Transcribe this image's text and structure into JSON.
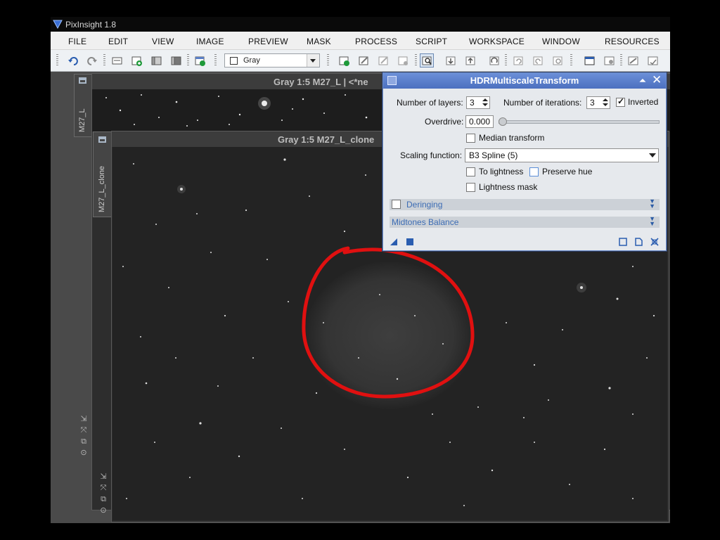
{
  "app": {
    "title": "PixInsight 1.8"
  },
  "menu": [
    "FILE",
    "EDIT",
    "VIEW",
    "IMAGE",
    "PREVIEW",
    "MASK",
    "PROCESS",
    "SCRIPT",
    "WORKSPACE",
    "WINDOW",
    "RESOURCES"
  ],
  "toolbar": {
    "color_mode": "Gray",
    "icons": [
      "undo-icon",
      "redo-icon",
      "new-image-icon",
      "duplicate-icon",
      "clone-icon",
      "mask-icon",
      "new-preview-icon",
      "zoom-icon",
      "process-icon"
    ]
  },
  "windows": {
    "back": {
      "title": "Gray 1:5 M27_L | <*ne",
      "tab": "M27_L"
    },
    "front": {
      "title": "Gray 1:5 M27_L_clone",
      "tab": "M27_L_clone"
    }
  },
  "dialog": {
    "title": "HDRMultiscaleTransform",
    "layers_label": "Number of layers:",
    "layers_value": "3",
    "iterations_label": "Number of iterations:",
    "iterations_value": "3",
    "inverted_label": "Inverted",
    "inverted_checked": true,
    "overdrive_label": "Overdrive:",
    "overdrive_value": "0.000",
    "overdrive_level": 0,
    "median_label": "Median transform",
    "scaling_label": "Scaling function:",
    "scaling_value": "B3 Spline (5)",
    "to_lightness_label": "To lightness",
    "preserve_hue_label": "Preserve hue",
    "lightness_mask_label": "Lightness mask",
    "sections": [
      "Deringing",
      "Midtones Balance"
    ]
  },
  "colors": {
    "annotation_circle": "#e01010",
    "dialog_title": "#5479c8",
    "section_text": "#3c6cb4"
  }
}
